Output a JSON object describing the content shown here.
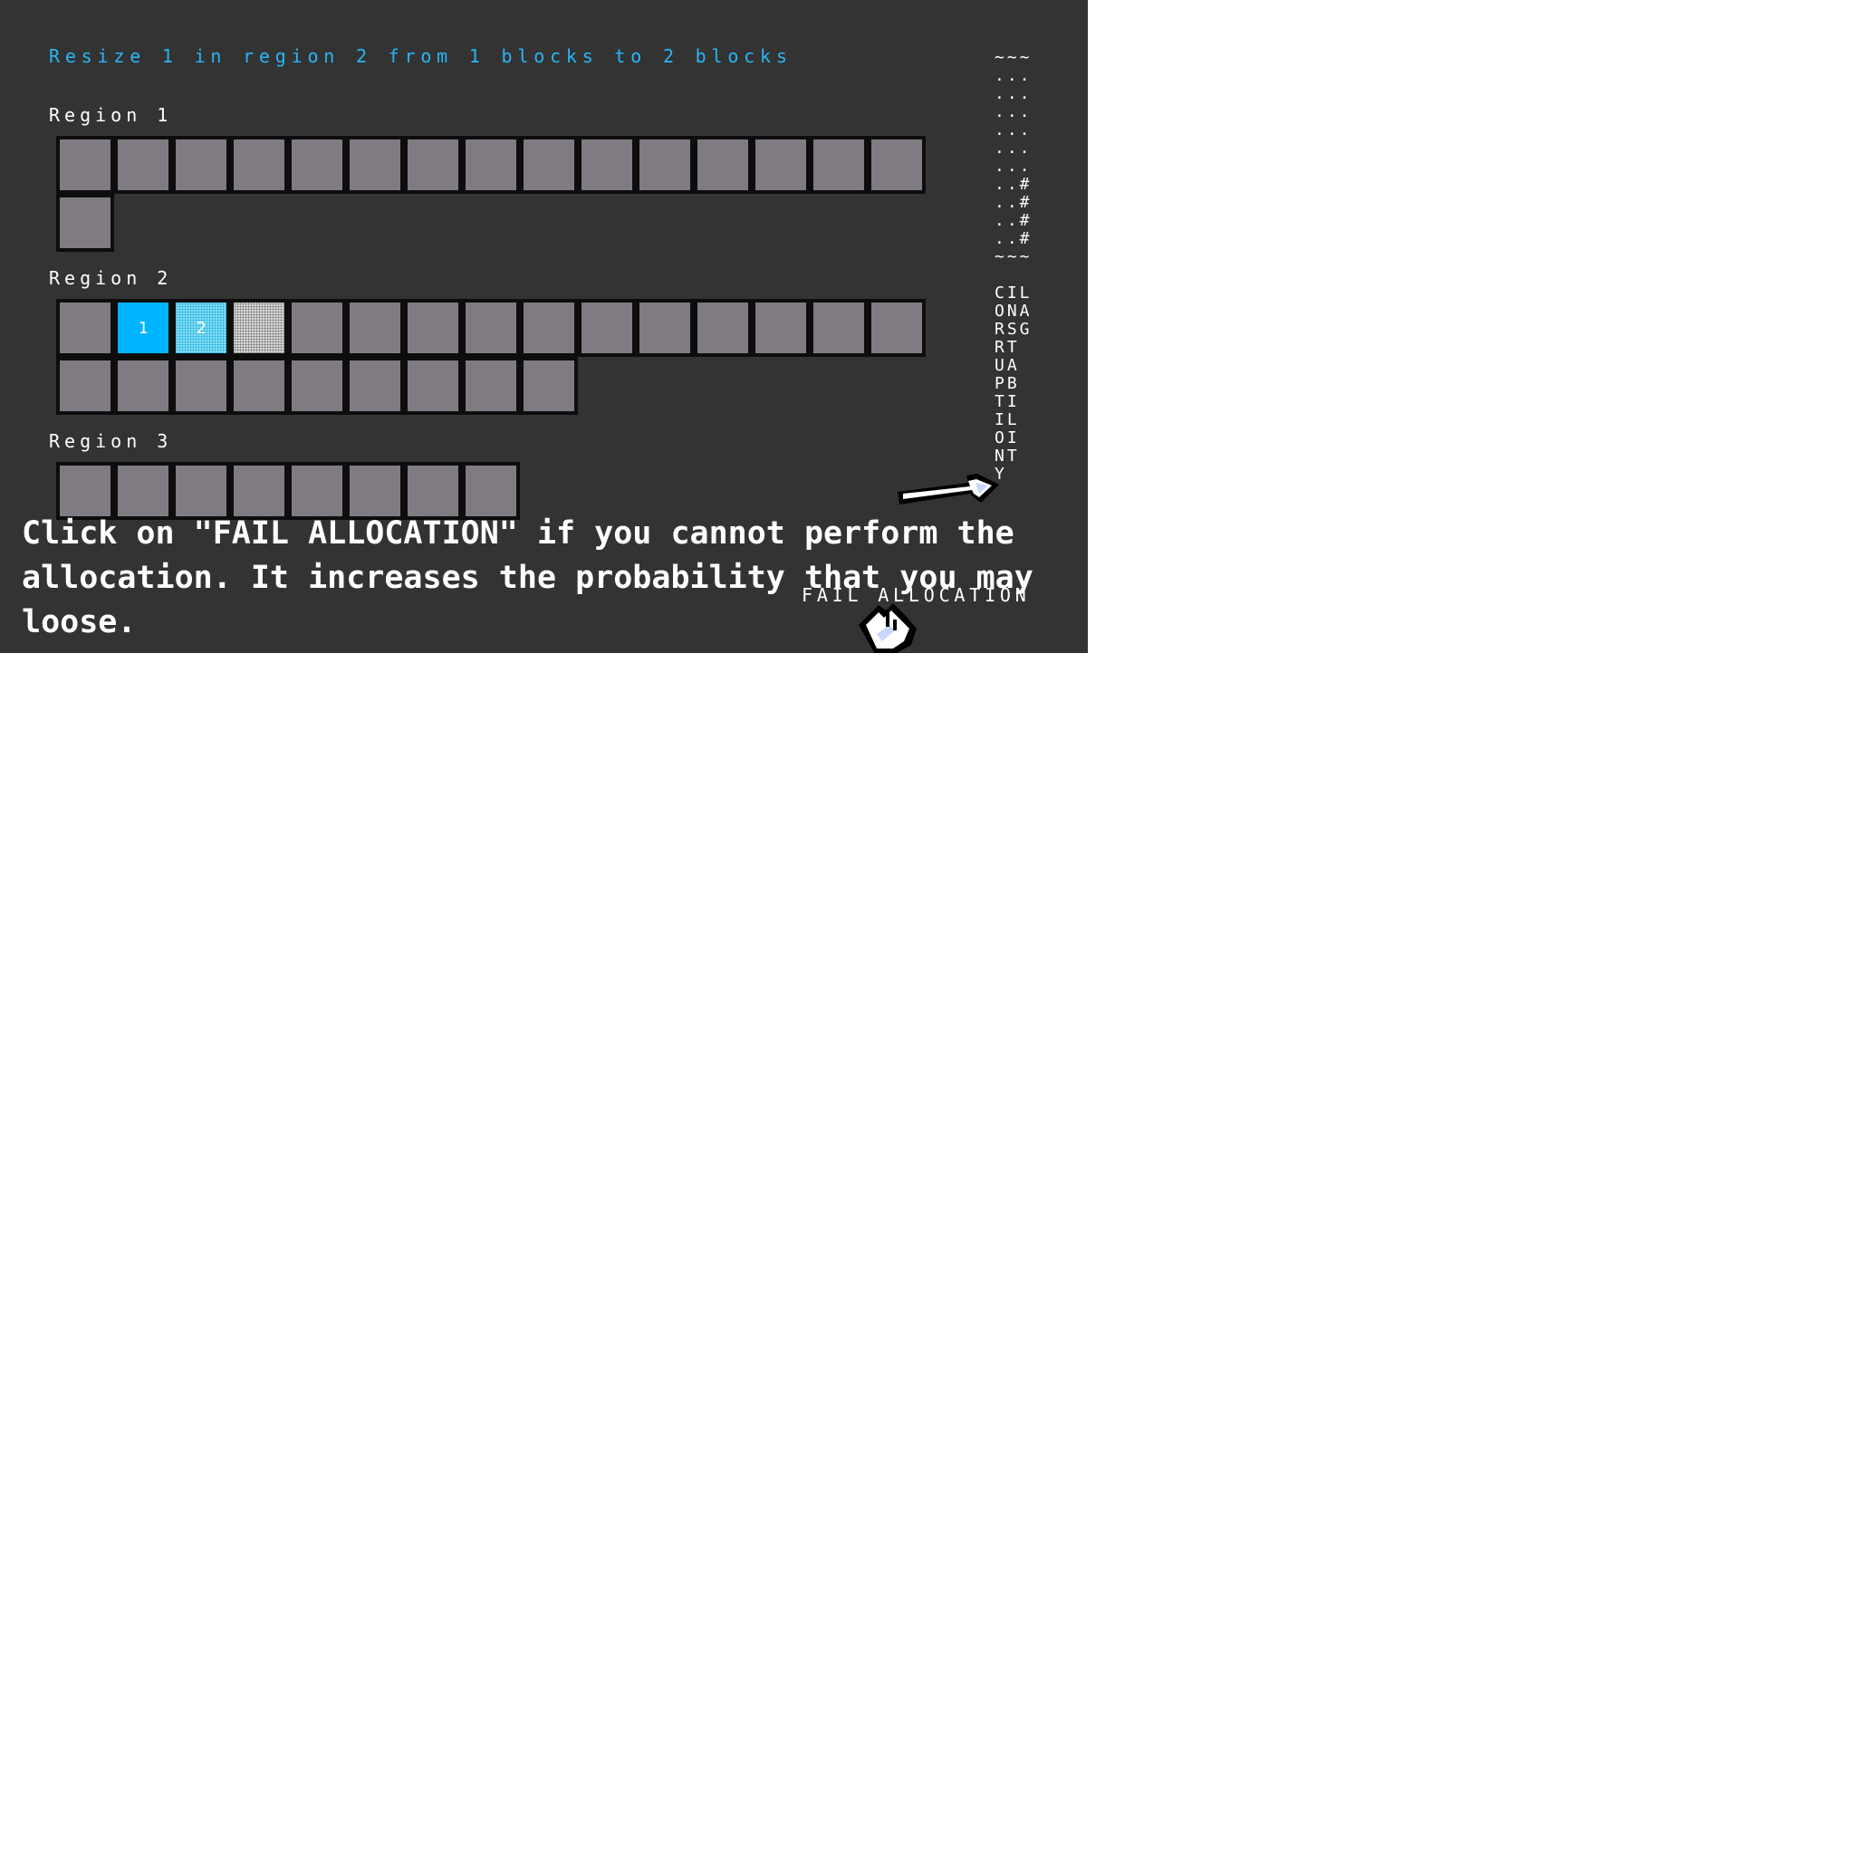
{
  "instruction": "Resize 1 in region 2 from 1 blocks to 2 blocks",
  "regions": [
    {
      "label": "Region 1"
    },
    {
      "label": "Region 2",
      "block_labels": {
        "current": "1",
        "target": "2"
      }
    },
    {
      "label": "Region 3"
    }
  ],
  "meter": {
    "cap": "~~~",
    "rows": [
      "...",
      "...",
      "...",
      "...",
      "...",
      "...",
      "..#",
      "..#",
      "..#",
      "..#"
    ]
  },
  "vertical_label": {
    "rows": [
      "CIL",
      "ONA",
      "RSG",
      "RT",
      "UA",
      "PB",
      "TI",
      "IL",
      "OI",
      "NT",
      "Y"
    ]
  },
  "hint": "Click on \"FAIL ALLOCATION\" if you cannot perform the allocation. It increases the probability that you may loose.",
  "fail_button": "FAIL ALLOCATION",
  "colors": {
    "background": "#333333",
    "instruction": "#29b6f6",
    "block": "#807b83",
    "current_block": "#00b4ff",
    "target_block": "#a6e7f8",
    "border": "#0d0d0d"
  },
  "icons": [
    "arrow-cursor-icon",
    "hand-cursor-icon"
  ]
}
